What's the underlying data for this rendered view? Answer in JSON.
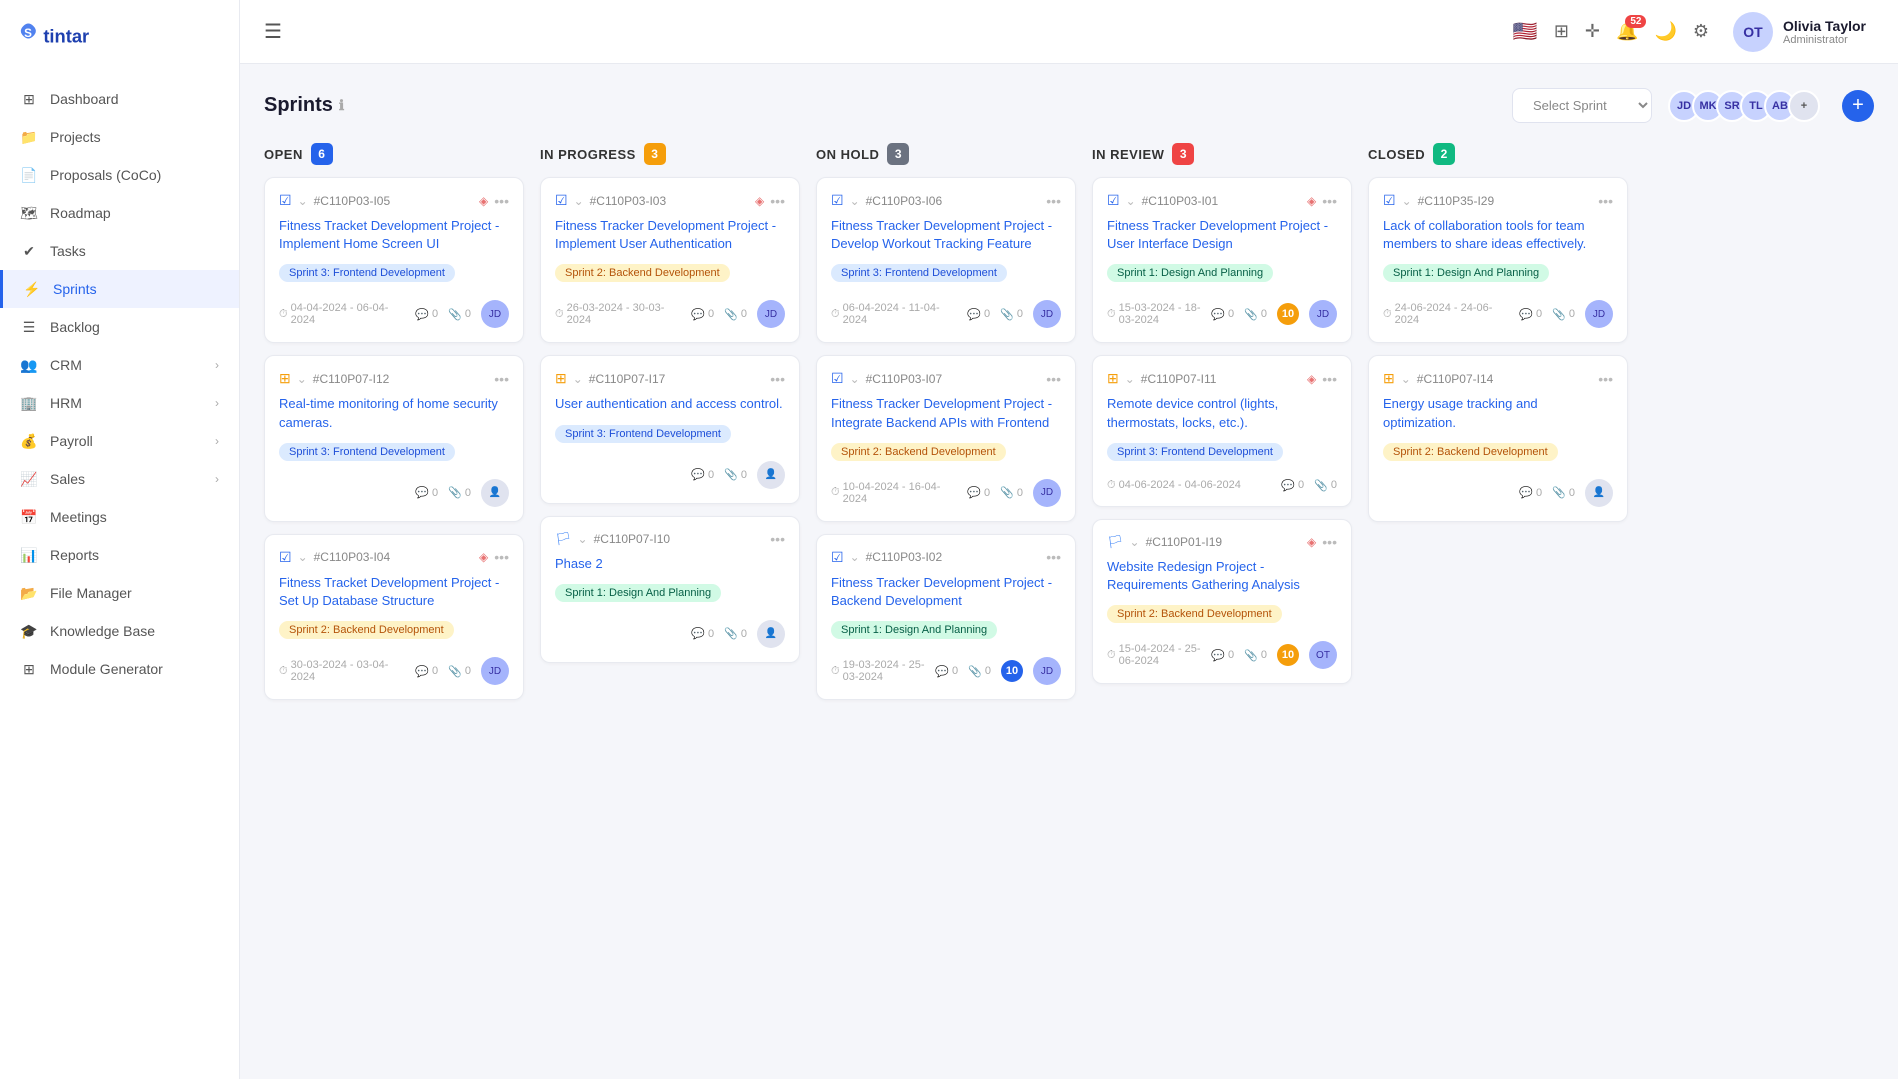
{
  "app": {
    "logo_text": "Stintar"
  },
  "sidebar": {
    "items": [
      {
        "id": "dashboard",
        "label": "Dashboard",
        "icon": "grid"
      },
      {
        "id": "projects",
        "label": "Projects",
        "icon": "folder"
      },
      {
        "id": "proposals",
        "label": "Proposals (CoCo)",
        "icon": "document"
      },
      {
        "id": "roadmap",
        "label": "Roadmap",
        "icon": "map"
      },
      {
        "id": "tasks",
        "label": "Tasks",
        "icon": "task"
      },
      {
        "id": "sprints",
        "label": "Sprints",
        "icon": "sprint",
        "active": true
      },
      {
        "id": "backlog",
        "label": "Backlog",
        "icon": "backlog"
      },
      {
        "id": "crm",
        "label": "CRM",
        "icon": "crm",
        "has_arrow": true
      },
      {
        "id": "hrm",
        "label": "HRM",
        "icon": "hrm",
        "has_arrow": true
      },
      {
        "id": "payroll",
        "label": "Payroll",
        "icon": "payroll",
        "has_arrow": true
      },
      {
        "id": "sales",
        "label": "Sales",
        "icon": "sales",
        "has_arrow": true
      },
      {
        "id": "meetings",
        "label": "Meetings",
        "icon": "meetings"
      },
      {
        "id": "reports",
        "label": "Reports",
        "icon": "reports"
      },
      {
        "id": "file-manager",
        "label": "File Manager",
        "icon": "file"
      },
      {
        "id": "knowledge-base",
        "label": "Knowledge Base",
        "icon": "knowledge"
      },
      {
        "id": "module-generator",
        "label": "Module Generator",
        "icon": "module"
      }
    ]
  },
  "topbar": {
    "hamburger_label": "☰",
    "user": {
      "name": "Olivia Taylor",
      "role": "Administrator",
      "initials": "OT"
    },
    "notification_count": "52"
  },
  "page": {
    "title": "Sprints",
    "sprint_select_placeholder": "Select Sprint",
    "add_button_label": "+"
  },
  "columns": [
    {
      "id": "open",
      "label": "OPEN",
      "count": "6",
      "badge_class": "badge-blue"
    },
    {
      "id": "in-progress",
      "label": "IN PROGRESS",
      "count": "3",
      "badge_class": "badge-yellow"
    },
    {
      "id": "on-hold",
      "label": "ON HOLD",
      "count": "3",
      "badge_class": "badge-gray"
    },
    {
      "id": "in-review",
      "label": "IN REVIEW",
      "count": "3",
      "badge_class": "badge-red"
    },
    {
      "id": "closed",
      "label": "CLOSED",
      "count": "2",
      "badge_class": "badge-green"
    }
  ],
  "cards": {
    "open": [
      {
        "id": "#C110P03-I05",
        "icon_type": "check",
        "title": "Fitness Tracket Development Project - Implement Home Screen UI",
        "tag": "Sprint 3: Frontend Development",
        "tag_class": "tag-frontend",
        "date": "04-04-2024 - 06-04-2024",
        "comments": "0",
        "attachments": "0",
        "avatar_class": "av-3",
        "avatar_initials": "JD",
        "has_avatar": true
      },
      {
        "id": "#C110P07-I12",
        "icon_type": "plus",
        "title": "Real-time monitoring of home security cameras.",
        "tag": "Sprint 3: Frontend Development",
        "tag_class": "tag-frontend",
        "date": "",
        "comments": "0",
        "attachments": "0",
        "has_avatar": false
      },
      {
        "id": "#C110P03-I04",
        "icon_type": "check",
        "title": "Fitness Tracket Development Project - Set Up Database Structure",
        "tag": "Sprint 2: Backend Development",
        "tag_class": "tag-backend",
        "date": "30-03-2024 - 03-04-2024",
        "comments": "0",
        "attachments": "0",
        "avatar_class": "av-3",
        "avatar_initials": "JD",
        "has_avatar": true
      }
    ],
    "in-progress": [
      {
        "id": "#C110P03-I03",
        "icon_type": "check",
        "title": "Fitness Tracker Development Project - Implement User Authentication",
        "tag": "Sprint 2: Backend Development",
        "tag_class": "tag-backend",
        "date": "26-03-2024 - 30-03-2024",
        "comments": "0",
        "attachments": "0",
        "avatar_class": "av-3",
        "avatar_initials": "JD",
        "has_avatar": true
      },
      {
        "id": "#C110P07-I17",
        "icon_type": "plus",
        "title": "User authentication and access control.",
        "tag": "Sprint 3: Frontend Development",
        "tag_class": "tag-frontend",
        "date": "",
        "comments": "0",
        "attachments": "0",
        "has_avatar": false
      },
      {
        "id": "#C110P07-I10",
        "icon_type": "flag",
        "title": "Phase 2",
        "tag": "Sprint 1: Design And Planning",
        "tag_class": "tag-planning",
        "date": "",
        "comments": "0",
        "attachments": "0",
        "has_avatar": false
      }
    ],
    "on-hold": [
      {
        "id": "#C110P03-I06",
        "icon_type": "check",
        "title": "Fitness Tracker Development Project - Develop Workout Tracking Feature",
        "tag": "Sprint 3: Frontend Development",
        "tag_class": "tag-frontend",
        "date": "06-04-2024 - 11-04-2024",
        "comments": "0",
        "attachments": "0",
        "avatar_class": "av-3",
        "avatar_initials": "JD",
        "has_avatar": true
      },
      {
        "id": "#C110P03-I07",
        "icon_type": "check",
        "title": "Fitness Tracker Development Project - Integrate Backend APIs with Frontend",
        "tag": "Sprint 2: Backend Development",
        "tag_class": "tag-backend",
        "date": "10-04-2024 - 16-04-2024",
        "comments": "0",
        "attachments": "0",
        "avatar_class": "av-3",
        "avatar_initials": "JD",
        "has_avatar": true
      },
      {
        "id": "#C110P03-I02",
        "icon_type": "check",
        "title": "Fitness Tracker Development Project - Backend Development",
        "tag": "Sprint 1: Design And Planning",
        "tag_class": "tag-planning",
        "date": "19-03-2024 - 25-03-2024",
        "comments": "0",
        "attachments": "0",
        "avatar_class": "av-3",
        "avatar_initials": "JD",
        "has_avatar": true,
        "num_badge": "10",
        "num_badge_class": "num-badge-blue"
      }
    ],
    "in-review": [
      {
        "id": "#C110P03-I01",
        "icon_type": "check",
        "title": "Fitness Tracker Development Project - User Interface Design",
        "tag": "Sprint 1: Design And Planning",
        "tag_class": "tag-planning",
        "date": "15-03-2024 - 18-03-2024",
        "comments": "0",
        "attachments": "0",
        "avatar_class": "av-3",
        "avatar_initials": "JD",
        "has_avatar": true,
        "num_badge": "10",
        "num_badge_class": "num-badge"
      },
      {
        "id": "#C110P07-I11",
        "icon_type": "plus",
        "title": "Remote device control (lights, thermostats, locks, etc.).",
        "tag": "Sprint 3: Frontend Development",
        "tag_class": "tag-frontend",
        "date": "04-06-2024 - 04-06-2024",
        "comments": "0",
        "attachments": "0",
        "has_avatar": false
      },
      {
        "id": "#C110P01-I19",
        "icon_type": "flag",
        "title": "Website Redesign Project - Requirements Gathering Analysis",
        "tag": "Sprint 2: Backend Development",
        "tag_class": "tag-backend",
        "date": "15-04-2024 - 25-06-2024",
        "comments": "0",
        "attachments": "0",
        "avatar_class": "av-3",
        "avatar_initials": "OT",
        "has_avatar": true,
        "num_badge": "10",
        "num_badge_class": "num-badge"
      }
    ],
    "closed": [
      {
        "id": "#C110P35-I29",
        "icon_type": "check",
        "title": "Lack of collaboration tools for team members to share ideas effectively.",
        "tag": "Sprint 1: Design And Planning",
        "tag_class": "tag-planning",
        "date": "24-06-2024 - 24-06-2024",
        "comments": "0",
        "attachments": "0",
        "avatar_class": "av-3",
        "avatar_initials": "JD",
        "has_avatar": true
      },
      {
        "id": "#C110P07-I14",
        "icon_type": "plus",
        "title": "Energy usage tracking and optimization.",
        "tag": "Sprint 2: Backend Development",
        "tag_class": "tag-backend",
        "date": "",
        "comments": "0",
        "attachments": "0",
        "has_avatar": false
      }
    ]
  },
  "avatar_group": [
    {
      "initials": "JD",
      "class": "av-3"
    },
    {
      "initials": "MK",
      "class": "av-1"
    },
    {
      "initials": "SR",
      "class": "av-2"
    },
    {
      "initials": "TL",
      "class": "av-4"
    },
    {
      "initials": "AB",
      "class": "av-5"
    },
    {
      "initials": "+",
      "class": "av-more"
    }
  ]
}
